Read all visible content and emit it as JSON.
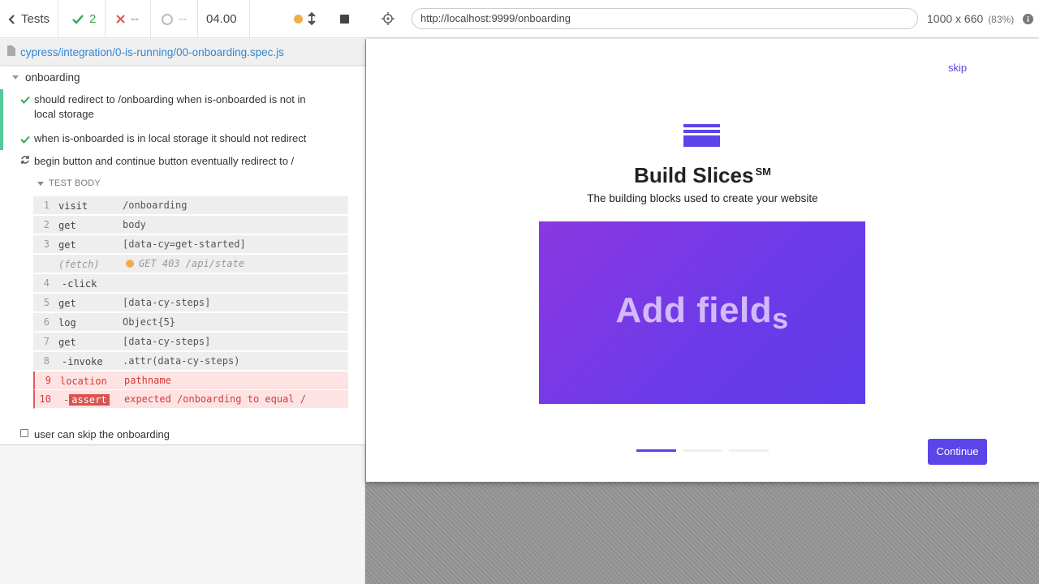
{
  "stats": {
    "tests_label": "Tests",
    "passed": "2",
    "failed": "--",
    "pending": "--",
    "duration": "04.00"
  },
  "spec": {
    "path": "cypress/integration/0-is-running/00-onboarding.spec.js"
  },
  "suite": {
    "title": "onboarding",
    "tests": [
      {
        "title": "should redirect to /onboarding when is-onboarded is not in local storage",
        "state": "passed"
      },
      {
        "title": "when is-onboarded is in local storage it should not redirect",
        "state": "passed"
      },
      {
        "title": "begin button and continue button eventually redirect to /",
        "state": "running"
      },
      {
        "title": "user can skip the onboarding",
        "state": "pending"
      }
    ]
  },
  "test_body": {
    "label": "TEST BODY",
    "commands": [
      {
        "n": "1",
        "name": "visit",
        "msg": "/onboarding"
      },
      {
        "n": "2",
        "name": "get",
        "msg": "body"
      },
      {
        "n": "3",
        "name": "get",
        "msg": "[data-cy=get-started]"
      },
      {
        "n": "",
        "name": "(fetch)",
        "msg": "GET 403 /api/state"
      },
      {
        "n": "4",
        "name": "-click",
        "msg": ""
      },
      {
        "n": "5",
        "name": "get",
        "msg": "[data-cy-steps]"
      },
      {
        "n": "6",
        "name": "log",
        "msg": "Object{5}"
      },
      {
        "n": "7",
        "name": "get",
        "msg": "[data-cy-steps]"
      },
      {
        "n": "8",
        "name": "-invoke",
        "msg": ".attr(data-cy-steps)"
      },
      {
        "n": "9",
        "name": "location",
        "msg": "pathname"
      },
      {
        "n": "10",
        "name": "assert",
        "msg": "expected /onboarding to equal /"
      }
    ]
  },
  "aut": {
    "url": "http://localhost:9999/onboarding",
    "viewport": "1000 x 660",
    "scale": "(83%)"
  },
  "app": {
    "skip": "skip",
    "title": "Build Slices",
    "title_mark": "SM",
    "subtitle": "The building blocks used to create your website",
    "hero_text": "Add field",
    "hero_text_tail": "s",
    "continue": "Continue",
    "step_active": 1,
    "step_total": 3,
    "brand_color": "#5b44e8"
  }
}
